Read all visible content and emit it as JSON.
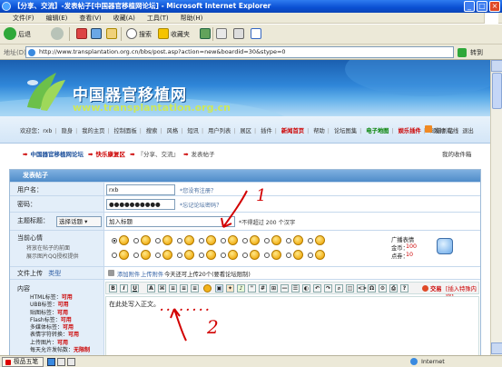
{
  "window": {
    "title": "【分享、交流】-发表帖子[中国器官移植网论坛] - Microsoft Internet Explorer",
    "menu": [
      "文件(F)",
      "编辑(E)",
      "查看(V)",
      "收藏(A)",
      "工具(T)",
      "帮助(H)"
    ],
    "back_label": "后退",
    "search_label": "搜索",
    "favorites_label": "收藏夹",
    "address_label": "地址(D)",
    "address_value": "http://www.transplantation.org.cn/bbs/post.asp?action=new&boardid=30&stype=0",
    "go_label": "转到",
    "status_zone": "Internet",
    "ime_label": "极品五笔"
  },
  "banner": {
    "title_cn": "中国器官移植网",
    "title_en": "www.transplantation.org.cn"
  },
  "nav": {
    "welcome": "欢迎您：rxb",
    "links": [
      "隐身",
      "我的主页",
      "控制面板",
      "搜索",
      "风格",
      "短讯",
      "用户列表",
      "展区",
      "插件"
    ],
    "highlight_red": "新闻首页",
    "links2": [
      "帮助",
      "论坛图集"
    ],
    "highlight_green": "电子地图",
    "highlight_red2": "娱乐插件",
    "links3": [
      "邮箱到站",
      "退出"
    ],
    "right": "发帖 在线"
  },
  "breadcrumb": {
    "items": [
      "中国器官移植网论坛",
      "快乐康复区",
      "『分享、交流』",
      "发表帖子"
    ],
    "right": "我的收件箱"
  },
  "form": {
    "header": "发表帖子",
    "username_label": "用户名：",
    "username_value": "rxb",
    "username_hint": "*您没有注册？",
    "password_label": "密码：",
    "password_value": "●●●●●●●●●●",
    "password_hint": "*忘记论坛密码？",
    "subject_label": "主题标题：",
    "subject_select": "选择话题",
    "subject_value": "加入标题",
    "subject_hint": "*不得超过 200 个汉字",
    "mood_label": "当前心情",
    "mood_desc1": "将放在帖子的前面",
    "mood_desc2": "展示图片QQ授权提供",
    "mood_side_title": "广播表情",
    "mood_side_gold_label": "金币：",
    "mood_side_gold": "100",
    "mood_side_points_label": "点券：",
    "mood_side_points": "10",
    "upload_label": "文件上传",
    "upload_type": "类型",
    "upload_link": "添加附件",
    "upload_link2": "上传附件",
    "upload_today": "今天还可上传20个(要看论坛限制)",
    "content_label": "内容",
    "content_rules": [
      {
        "k": "HTML标签：",
        "v": "可用"
      },
      {
        "k": "UBB标签：",
        "v": "可用"
      },
      {
        "k": "贴图标签：",
        "v": "可用"
      },
      {
        "k": "Flash标签：",
        "v": "可用"
      },
      {
        "k": "多媒体标签：",
        "v": "可用"
      },
      {
        "k": "表情字符转换：",
        "v": "可用"
      },
      {
        "k": "上传图片：",
        "v": "可用"
      },
      {
        "k": "每天允许发帖数：",
        "v": "无限制"
      }
    ],
    "editor_right": "交易",
    "editor_right2": "[插入特殊内容]",
    "body_text": "在此处写入正文。"
  },
  "annotations": {
    "mark1": "1",
    "mark2": "2",
    "dots": "........"
  }
}
